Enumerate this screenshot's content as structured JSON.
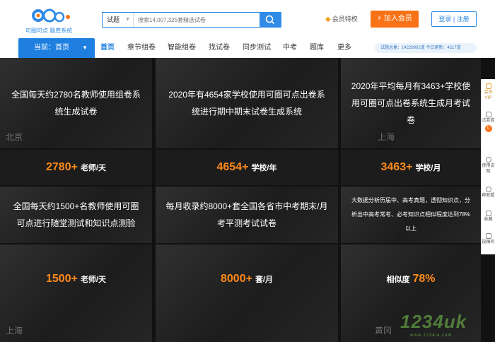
{
  "brand": {
    "logo_text": "可圈可点 题库系统"
  },
  "search": {
    "type_label": "试题",
    "placeholder": "搜索14,007,325套精选试卷"
  },
  "header": {
    "vip_label": "会员特权",
    "join_label": "加入会员",
    "auth_label": "登录 | 注册"
  },
  "nav": {
    "current_label": "当前：首页",
    "items": [
      "首页",
      "章节组卷",
      "智能组卷",
      "找试卷",
      "同步测试",
      "中考",
      "题库",
      "更多"
    ],
    "stats_text": "试题总量：14229902道    今日更新：4217道"
  },
  "grid": {
    "row1": [
      {
        "text": "全国每天约2780名教师使用组卷系统生成试卷",
        "city": "北京"
      },
      {
        "text": "2020年有4654家学校使用可圈可点出卷系统进行期中期末试卷生成系统",
        "city": ""
      },
      {
        "text": "2020年平均每月有3463+学校使用可圈可点出卷系统生成月考试卷",
        "city": "上海"
      }
    ],
    "row2": [
      {
        "num": "2780+",
        "unit": "老师/天"
      },
      {
        "num": "4654+",
        "unit": "学校/年"
      },
      {
        "num": "3463+",
        "unit": "学校/月"
      }
    ],
    "row3": [
      {
        "text": "全国每天约1500+名教师使用可圈可点进行随堂测试和知识点测验",
        "city": ""
      },
      {
        "text": "每月收录约8000+套全国各省市中考期末/月考平测考试试卷",
        "city": ""
      },
      {
        "text": "大数据分析历届中、高考真题，透彻知识点，分析出中高考常考、必考知识点相似程度达到78%以上",
        "city": ""
      }
    ],
    "row4": [
      {
        "num": "1500+",
        "unit": "老师/天",
        "city": "上海"
      },
      {
        "num": "8000+",
        "unit": "套/月",
        "city": ""
      },
      {
        "num": "78%",
        "unit": "相似度",
        "city": "黄冈"
      }
    ]
  },
  "sidebar": {
    "items": [
      {
        "label": "会员VIP",
        "icon": "diamond-icon"
      },
      {
        "label": "试卷篮",
        "icon": "basket-icon",
        "badge": "0"
      },
      {
        "label": "使用说明",
        "icon": "help-icon"
      },
      {
        "label": "群联盟",
        "icon": "group-icon"
      },
      {
        "label": "收藏",
        "icon": "star-icon"
      },
      {
        "label": "投稿有",
        "icon": "edit-icon"
      }
    ]
  },
  "watermark": {
    "text": "1234uk",
    "sub": "www.1234la.com"
  },
  "colors": {
    "primary": "#1e7fe0",
    "accent": "#f97316",
    "highlight": "#ff8a1a"
  }
}
